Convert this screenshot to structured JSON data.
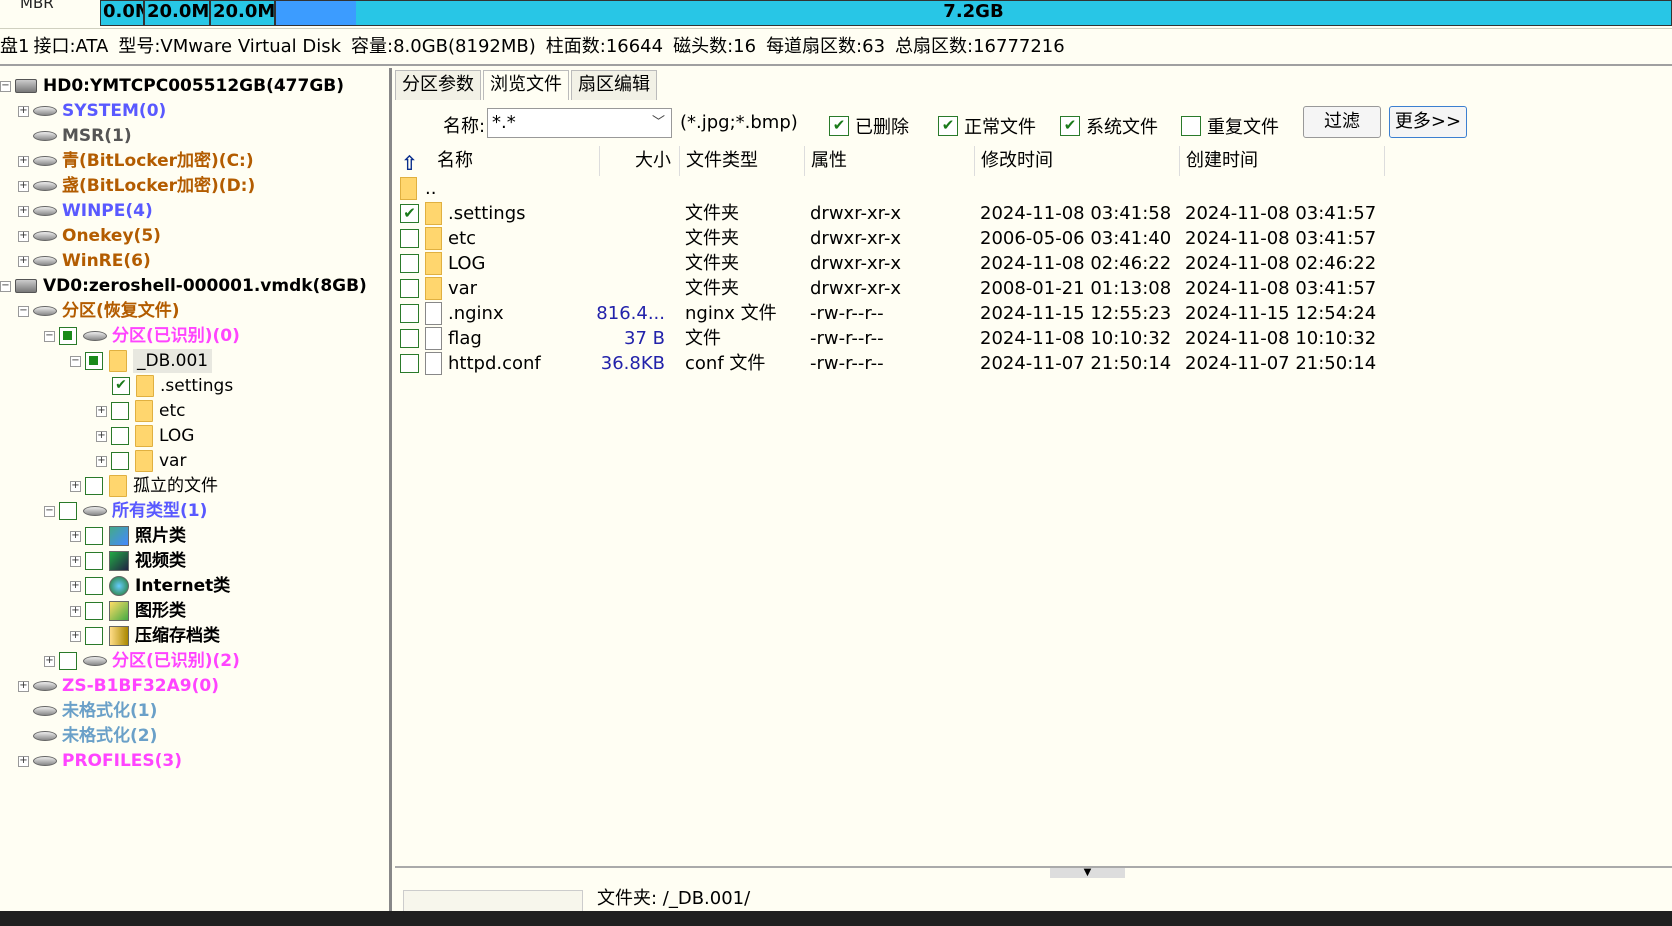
{
  "partition_bar": {
    "mbr_label": "MBR",
    "segments": [
      "0.0MI",
      "20.0MI",
      "20.0MI"
    ],
    "main_size": "7.2GB"
  },
  "disk_info": {
    "disk": "盘1",
    "interface": "接口:ATA",
    "model": "型号:VMware Virtual Disk",
    "capacity": "容量:8.0GB(8192MB)",
    "cylinders": "柱面数:16644",
    "heads": "磁头数:16",
    "sectors_per_track": "每道扇区数:63",
    "total_sectors": "总扇区数:16777216"
  },
  "tree": {
    "hd0": "HD0:YMTCPC005512GB(477GB)",
    "hd0_parts": [
      "SYSTEM(0)",
      "MSR(1)",
      "青(BitLocker加密)(C:)",
      "盏(BitLocker加密)(D:)",
      "WINPE(4)",
      "Onekey(5)",
      "WinRE(6)"
    ],
    "vd0": "VD0:zeroshell-000001.vmdk(8GB)",
    "recover": "分区(恢复文件)",
    "recognized0": "分区(已识别)(0)",
    "db001": "_DB.001",
    "db_children": [
      ".settings",
      "etc",
      "LOG",
      "var"
    ],
    "orphan": "孤立的文件",
    "all_types": "所有类型(1)",
    "types": [
      "照片类",
      "视频类",
      "Internet类",
      "图形类",
      "压缩存档类"
    ],
    "recognized2": "分区(已识别)(2)",
    "other_parts": [
      "ZS-B1BF32A9(0)",
      "未格式化(1)",
      "未格式化(2)",
      "PROFILES(3)"
    ]
  },
  "tabs": [
    "分区参数",
    "浏览文件",
    "扇区编辑"
  ],
  "toolbar": {
    "name_label": "名称:",
    "name_value": "*.*",
    "hint": "(*.jpg;*.bmp)",
    "chk_deleted": "已删除",
    "chk_normal": "正常文件",
    "chk_system": "系统文件",
    "chk_duplicate": "重复文件",
    "filter": "过滤",
    "more": "更多>>"
  },
  "columns": [
    "名称",
    "大小",
    "文件类型",
    "属性",
    "修改时间",
    "创建时间"
  ],
  "parent_dir": "..",
  "files": [
    {
      "name": ".settings",
      "size": "",
      "type": "文件夹",
      "attr": "drwxr-xr-x",
      "mtime": "2024-11-08 03:41:58",
      "ctime": "2024-11-08 03:41:57",
      "checked": "✔"
    },
    {
      "name": "etc",
      "size": "",
      "type": "文件夹",
      "attr": "drwxr-xr-x",
      "mtime": "2006-05-06 03:41:40",
      "ctime": "2024-11-08 03:41:57",
      "checked": ""
    },
    {
      "name": "LOG",
      "size": "",
      "type": "文件夹",
      "attr": "drwxr-xr-x",
      "mtime": "2024-11-08 02:46:22",
      "ctime": "2024-11-08 02:46:22",
      "checked": ""
    },
    {
      "name": "var",
      "size": "",
      "type": "文件夹",
      "attr": "drwxr-xr-x",
      "mtime": "2008-01-21 01:13:08",
      "ctime": "2024-11-08 03:41:57",
      "checked": ""
    },
    {
      "name": ".nginx",
      "size": "816.4...",
      "type": "nginx 文件",
      "attr": "-rw-r--r--",
      "mtime": "2024-11-15 12:55:23",
      "ctime": "2024-11-15 12:54:24",
      "checked": ""
    },
    {
      "name": "flag",
      "size": "37 B",
      "type": "文件",
      "attr": "-rw-r--r--",
      "mtime": "2024-11-08 10:10:32",
      "ctime": "2024-11-08 10:10:32",
      "checked": ""
    },
    {
      "name": "httpd.conf",
      "size": "36.8KB",
      "type": "conf 文件",
      "attr": "-rw-r--r--",
      "mtime": "2024-11-07 21:50:14",
      "ctime": "2024-11-07 21:50:14",
      "checked": ""
    }
  ],
  "status": {
    "path": "文件夹: /_DB.001/"
  }
}
